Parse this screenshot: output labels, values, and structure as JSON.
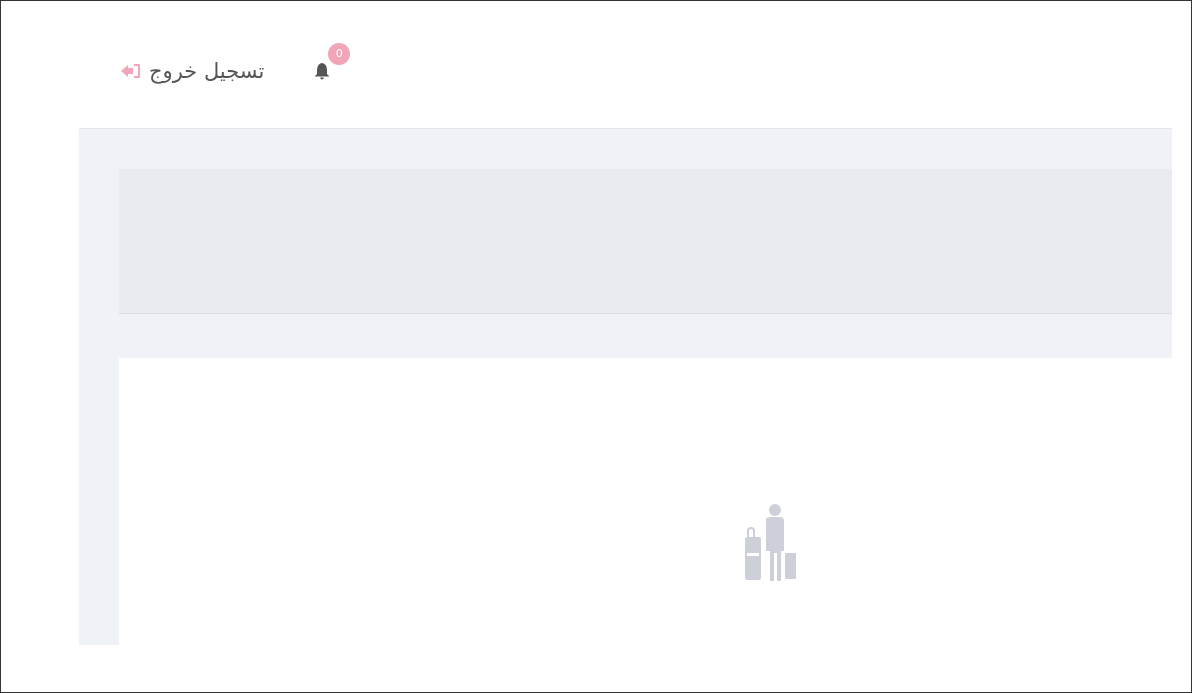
{
  "header": {
    "logout": {
      "label": "تسجيل خروج"
    },
    "notifications": {
      "count": "0"
    }
  }
}
